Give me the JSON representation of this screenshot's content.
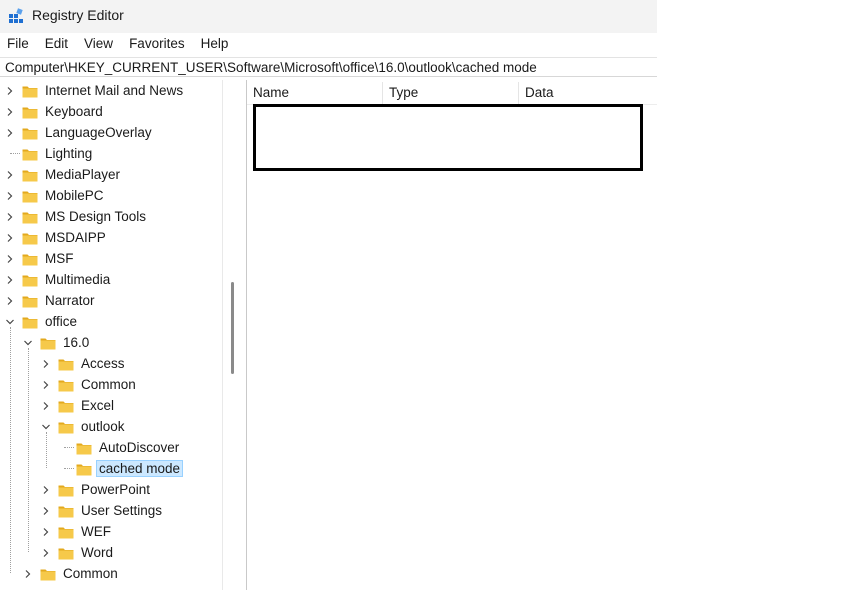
{
  "window": {
    "title": "Registry Editor"
  },
  "menu": [
    "File",
    "Edit",
    "View",
    "Favorites",
    "Help"
  ],
  "address": "Computer\\HKEY_CURRENT_USER\\Software\\Microsoft\\office\\16.0\\outlook\\cached mode",
  "tree": [
    {
      "label": "Internet Mail and News",
      "expander": "collapsed"
    },
    {
      "label": "Keyboard",
      "expander": "collapsed"
    },
    {
      "label": "LanguageOverlay",
      "expander": "collapsed"
    },
    {
      "label": "Lighting",
      "expander": "none"
    },
    {
      "label": "MediaPlayer",
      "expander": "collapsed"
    },
    {
      "label": "MobilePC",
      "expander": "collapsed"
    },
    {
      "label": "MS Design Tools",
      "expander": "collapsed"
    },
    {
      "label": "MSDAIPP",
      "expander": "collapsed"
    },
    {
      "label": "MSF",
      "expander": "collapsed"
    },
    {
      "label": "Multimedia",
      "expander": "collapsed"
    },
    {
      "label": "Narrator",
      "expander": "collapsed"
    },
    {
      "label": "office",
      "expander": "expanded"
    },
    {
      "label": "16.0",
      "expander": "expanded"
    },
    {
      "label": "Access",
      "expander": "collapsed"
    },
    {
      "label": "Common",
      "expander": "collapsed"
    },
    {
      "label": "Excel",
      "expander": "collapsed"
    },
    {
      "label": "outlook",
      "expander": "expanded"
    },
    {
      "label": "AutoDiscover",
      "expander": "none"
    },
    {
      "label": "cached mode",
      "expander": "none",
      "selected": true
    },
    {
      "label": "PowerPoint",
      "expander": "collapsed"
    },
    {
      "label": "User Settings",
      "expander": "collapsed"
    },
    {
      "label": "WEF",
      "expander": "collapsed"
    },
    {
      "label": "Word",
      "expander": "collapsed"
    },
    {
      "label": "Common",
      "expander": "collapsed"
    }
  ],
  "list": {
    "columns": [
      "Name",
      "Type",
      "Data"
    ]
  },
  "colors": {
    "folder": "#f6c94a",
    "folder_dark": "#e3a91e",
    "selection_bg": "#cce8ff",
    "selection_border": "#99d1ff",
    "app_icon": "#1f6fd1"
  }
}
